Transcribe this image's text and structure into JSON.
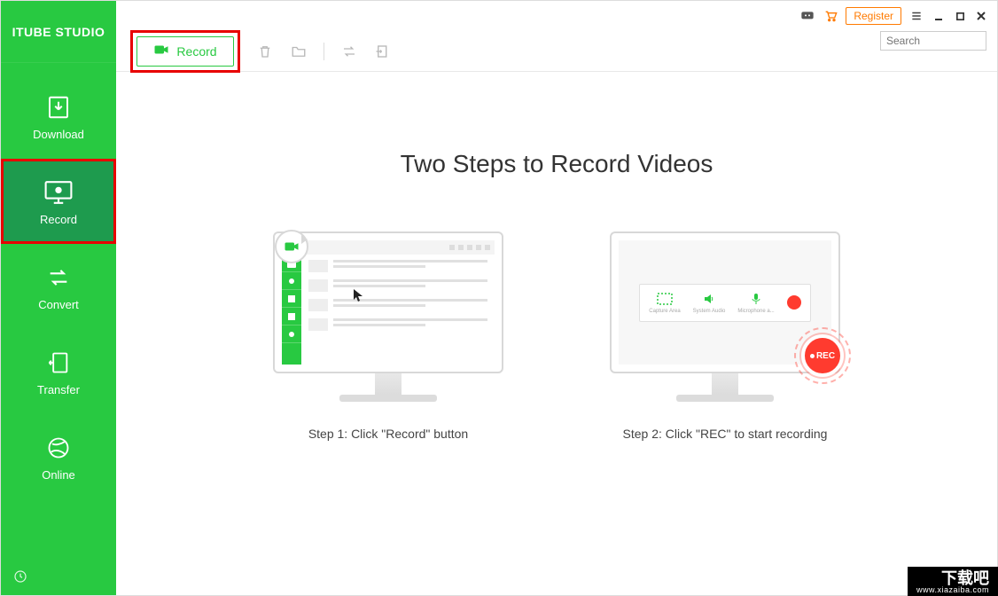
{
  "app": {
    "logo": "ITUBE STUDIO"
  },
  "sidebar": {
    "items": [
      {
        "label": "Download",
        "icon": "download-icon"
      },
      {
        "label": "Record",
        "icon": "record-screen-icon"
      },
      {
        "label": "Convert",
        "icon": "convert-icon"
      },
      {
        "label": "Transfer",
        "icon": "transfer-icon"
      },
      {
        "label": "Online",
        "icon": "globe-icon"
      }
    ]
  },
  "titlebar": {
    "register_label": "Register",
    "icons": {
      "discord": "discord-icon",
      "cart": "cart-icon",
      "menu": "menu-icon",
      "minimize": "minimize-icon",
      "maximize": "maximize-icon",
      "close": "close-icon"
    }
  },
  "search": {
    "placeholder": "Search"
  },
  "toolbar": {
    "record_label": "Record",
    "icons": {
      "trash": "trash-icon",
      "folder": "folder-icon",
      "loop": "loop-icon",
      "import": "import-icon"
    }
  },
  "content": {
    "heading": "Two Steps to Record Videos",
    "step1_caption": "Step 1: Click \"Record\" button",
    "step2_caption": "Step 2: Click \"REC\" to start recording",
    "rec_badge": "REC",
    "panel_options": [
      "Capture Area",
      "System Audio",
      "Microphone a..."
    ]
  },
  "watermark": {
    "main": "下载吧",
    "sub": "www.xiazaiba.com"
  }
}
